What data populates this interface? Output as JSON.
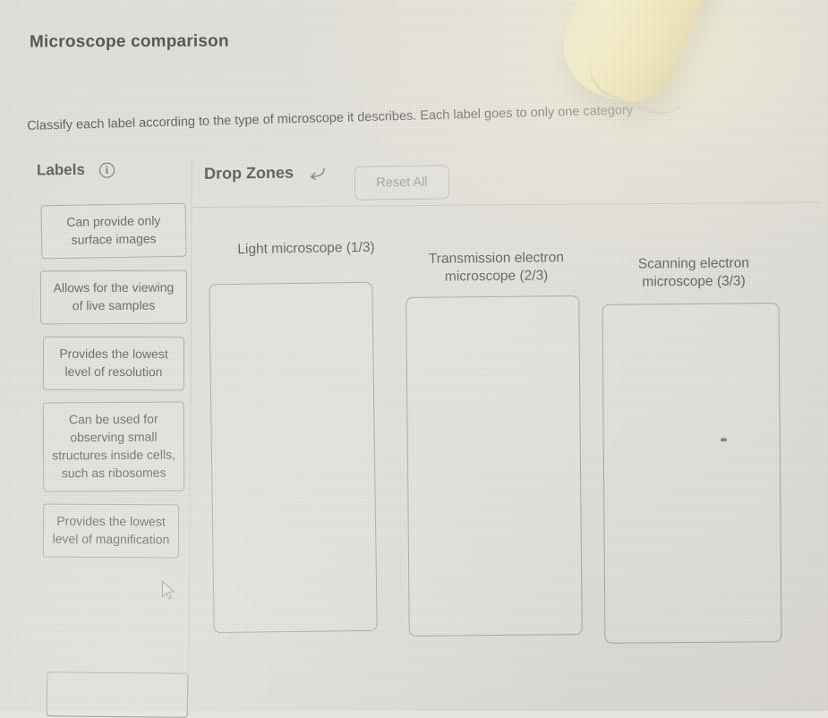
{
  "page": {
    "title": "Microscope comparison",
    "instruction": "Classify each label according to the type of microscope it describes. Each label goes to only one category"
  },
  "labels_panel": {
    "title": "Labels",
    "info_icon": "info-icon",
    "cards": [
      {
        "text": "Can provide only surface images"
      },
      {
        "text": "Allows for the viewing of live samples"
      },
      {
        "text": "Provides the lowest level of resolution"
      },
      {
        "text": "Can be used for observing small structures inside cells, such as ribosomes"
      },
      {
        "text": "Provides the lowest level of magnification"
      }
    ]
  },
  "dropzones_panel": {
    "title": "Drop Zones",
    "undo_icon": "undo-arrow-icon",
    "reset_label": "Reset All",
    "zones": [
      {
        "title": "Light microscope (1/3)",
        "count": "1/3",
        "items": []
      },
      {
        "title": "Transmission electron microscope (2/3)",
        "count": "2/3",
        "items": []
      },
      {
        "title": "Scanning electron microscope (3/3)",
        "count": "3/3",
        "items": []
      }
    ]
  },
  "colors": {
    "background": "#e6e4de",
    "text": "#3b3d3c",
    "card_border": "#9fa29d",
    "muted_text": "#8f9290",
    "object_highlight": "#fdf4c9"
  }
}
